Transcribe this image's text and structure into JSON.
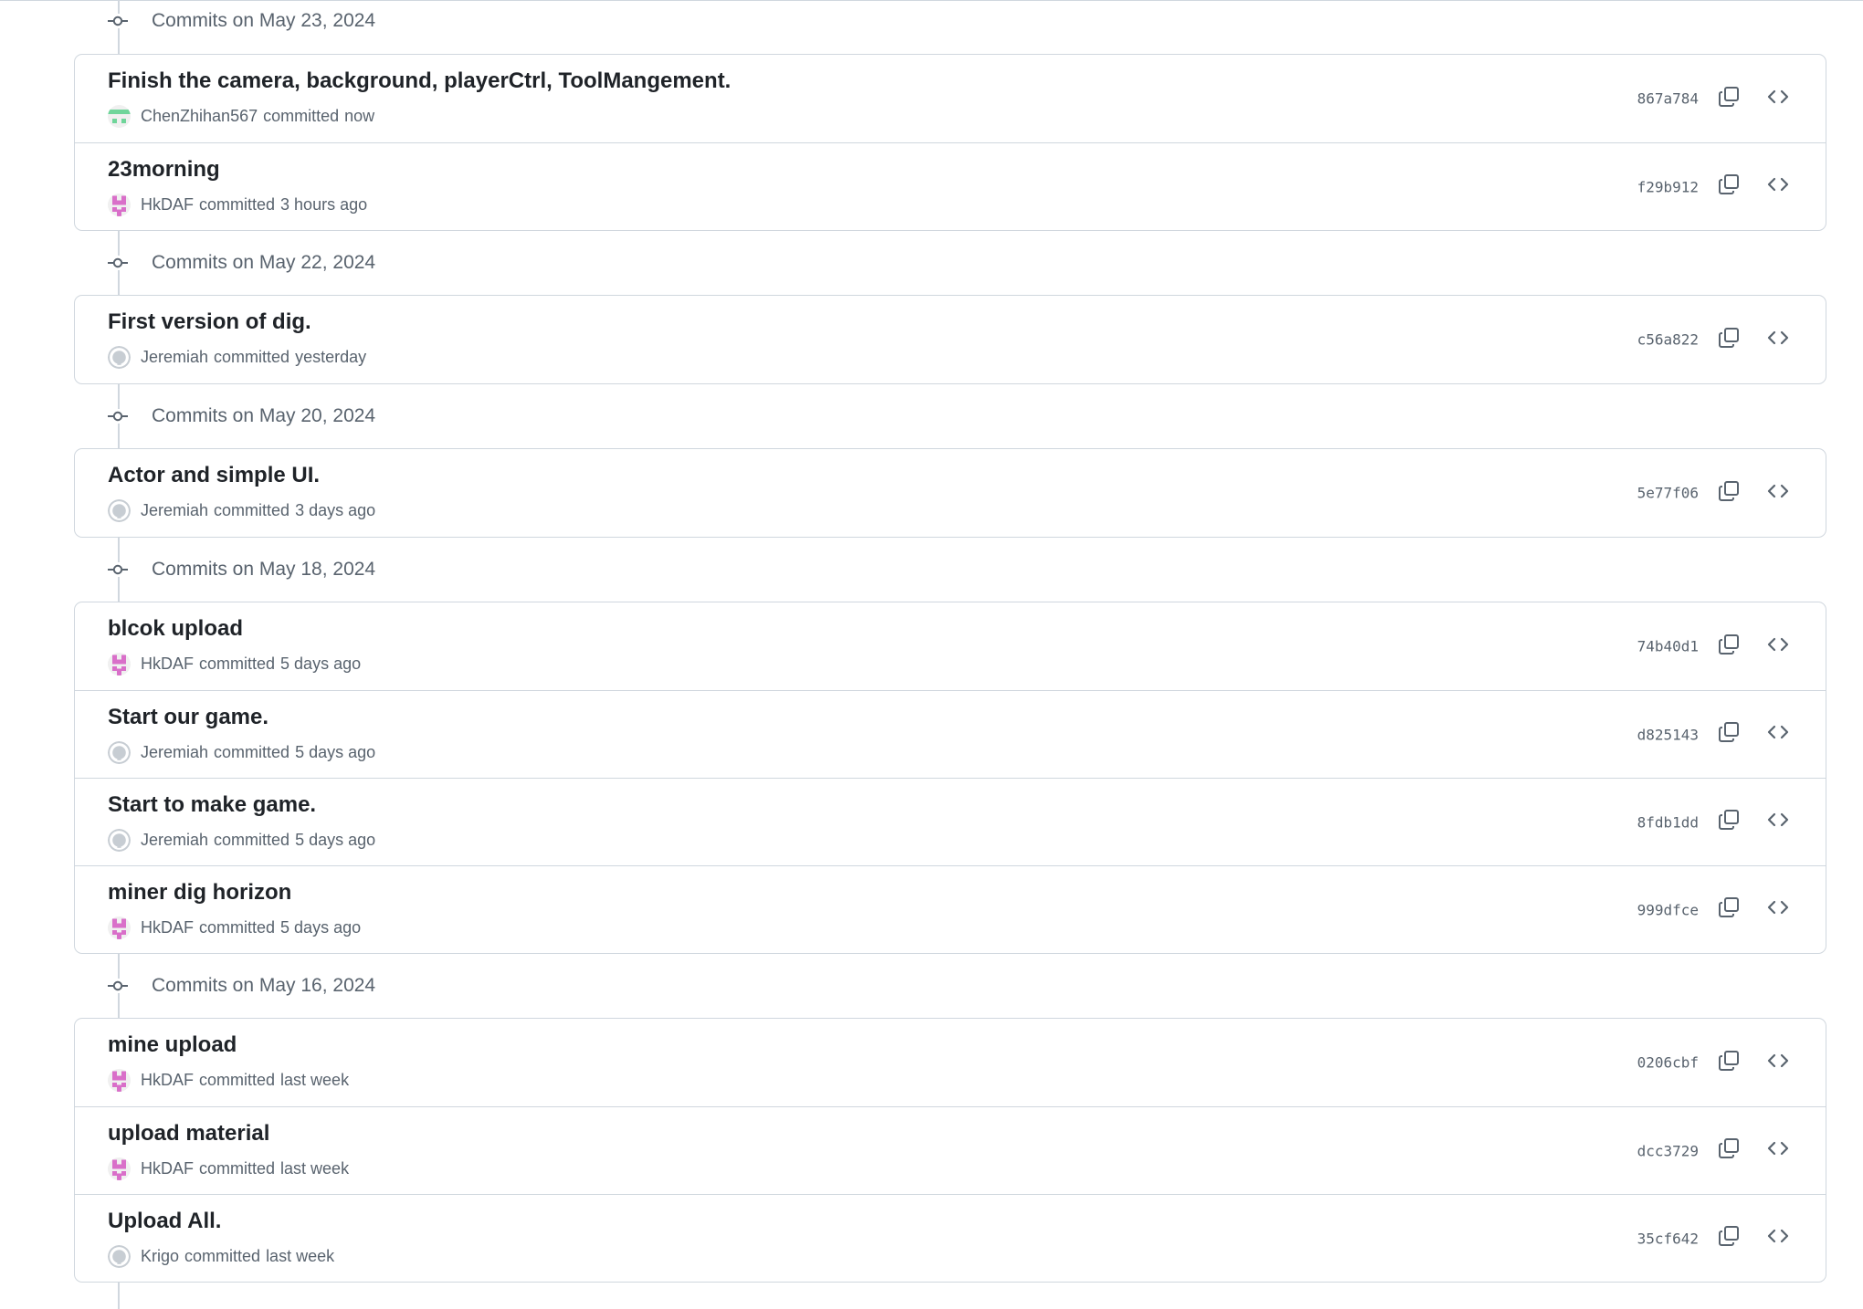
{
  "groups": [
    {
      "date_label": "Commits on May 23, 2024",
      "commits": [
        {
          "title": "Finish the camera, background, playerCtrl, ToolMangement.",
          "author": "ChenZhihan567",
          "verb": "committed",
          "time": "now",
          "sha": "867a784",
          "avatar_icon": "identicon-green-avatar",
          "avatar_color": "#6fd59a"
        },
        {
          "title": "23morning",
          "author": "HkDAF",
          "verb": "committed",
          "time": "3 hours ago",
          "sha": "f29b912",
          "avatar_icon": "identicon-pink-avatar",
          "avatar_color": "#d96fc9"
        }
      ]
    },
    {
      "date_label": "Commits on May 22, 2024",
      "commits": [
        {
          "title": "First version of dig.",
          "author": "Jeremiah",
          "verb": "committed",
          "time": "yesterday",
          "sha": "c56a822",
          "avatar_icon": "default-gray-avatar",
          "avatar_color": "#c7cdd3"
        }
      ]
    },
    {
      "date_label": "Commits on May 20, 2024",
      "commits": [
        {
          "title": "Actor and simple UI.",
          "author": "Jeremiah",
          "verb": "committed",
          "time": "3 days ago",
          "sha": "5e77f06",
          "avatar_icon": "default-gray-avatar",
          "avatar_color": "#c7cdd3"
        }
      ]
    },
    {
      "date_label": "Commits on May 18, 2024",
      "commits": [
        {
          "title": "blcok upload",
          "author": "HkDAF",
          "verb": "committed",
          "time": "5 days ago",
          "sha": "74b40d1",
          "avatar_icon": "identicon-pink-avatar",
          "avatar_color": "#d96fc9"
        },
        {
          "title": "Start our game.",
          "author": "Jeremiah",
          "verb": "committed",
          "time": "5 days ago",
          "sha": "d825143",
          "avatar_icon": "default-gray-avatar",
          "avatar_color": "#c7cdd3"
        },
        {
          "title": "Start to make game.",
          "author": "Jeremiah",
          "verb": "committed",
          "time": "5 days ago",
          "sha": "8fdb1dd",
          "avatar_icon": "default-gray-avatar",
          "avatar_color": "#c7cdd3"
        },
        {
          "title": "miner dig horizon",
          "author": "HkDAF",
          "verb": "committed",
          "time": "5 days ago",
          "sha": "999dfce",
          "avatar_icon": "identicon-pink-avatar",
          "avatar_color": "#d96fc9"
        }
      ]
    },
    {
      "date_label": "Commits on May 16, 2024",
      "commits": [
        {
          "title": "mine upload",
          "author": "HkDAF",
          "verb": "committed",
          "time": "last week",
          "sha": "0206cbf",
          "avatar_icon": "identicon-pink-avatar",
          "avatar_color": "#d96fc9"
        },
        {
          "title": "upload material",
          "author": "HkDAF",
          "verb": "committed",
          "time": "last week",
          "sha": "dcc3729",
          "avatar_icon": "identicon-pink-avatar",
          "avatar_color": "#d96fc9"
        },
        {
          "title": "Upload All.",
          "author": "Krigo",
          "verb": "committed",
          "time": "last week",
          "sha": "35cf642",
          "avatar_icon": "default-gray-avatar",
          "avatar_color": "#c7cdd3"
        }
      ]
    }
  ],
  "icons": {
    "commit_node": "git-commit-icon",
    "copy": "copy-icon",
    "browse": "code-brackets-icon"
  },
  "colors": {
    "border": "#d0d7de",
    "muted_text": "#59636e",
    "primary_text": "#1f2328"
  }
}
